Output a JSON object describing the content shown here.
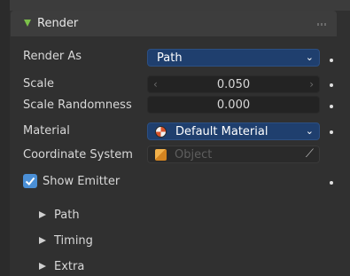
{
  "header": {
    "title": "Render"
  },
  "rows": {
    "render_as": {
      "label": "Render As",
      "value": "Path"
    },
    "scale": {
      "label": "Scale",
      "value": "0.050"
    },
    "scale_randomness": {
      "label": "Scale Randomness",
      "value": "0.000"
    },
    "material": {
      "label": "Material",
      "value": "Default Material"
    },
    "coordinate_system": {
      "label": "Coordinate System",
      "placeholder": "Object"
    }
  },
  "show_emitter": {
    "label": "Show Emitter",
    "checked": true
  },
  "subpanels": [
    {
      "label": "Path"
    },
    {
      "label": "Timing"
    },
    {
      "label": "Extra"
    }
  ],
  "colors": {
    "accent": "#4a8fd6",
    "dropdown_bg": "#1f3f6e",
    "panel_bg": "#303030",
    "header_triangle": "#7cc14a"
  }
}
